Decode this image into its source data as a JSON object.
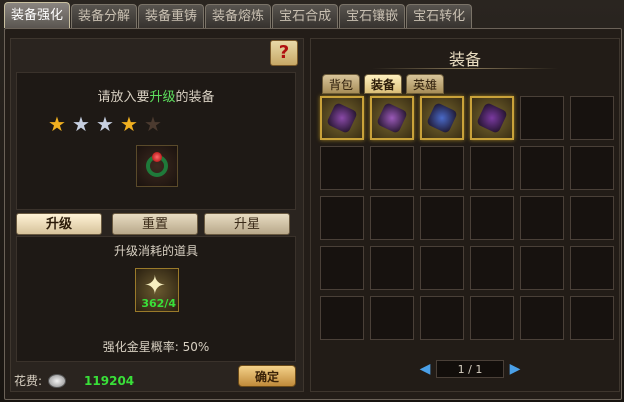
{
  "top_tabs": [
    "装备强化",
    "装备分解",
    "装备重铸",
    "装备熔炼",
    "宝石合成",
    "宝石镶嵌",
    "宝石转化"
  ],
  "active_top_tab": 0,
  "help_icon": "?",
  "prompt": {
    "prefix": "请放入要",
    "highlight": "升级",
    "suffix": "的装备"
  },
  "stars": [
    {
      "icon": "gold-star-icon",
      "glyph": "★"
    },
    {
      "icon": "silver-star-icon",
      "glyph": "★"
    },
    {
      "icon": "silver-star-icon",
      "glyph": "★"
    },
    {
      "icon": "gold-star-icon",
      "glyph": "★"
    },
    {
      "icon": "empty-star-icon",
      "glyph": "★"
    }
  ],
  "sub_tabs": [
    "升级",
    "重置",
    "升星"
  ],
  "active_sub_tab": 0,
  "cost_label": "升级消耗的道具",
  "material": {
    "icon": "star-material-icon",
    "glyph": "✦",
    "count": "362/4"
  },
  "success_rate": "强化金星概率: 50%",
  "cost_row": {
    "label": "花费:",
    "icon": "silver-coin-icon",
    "value": "119204"
  },
  "confirm_label": "确定",
  "right": {
    "title": "装备",
    "tabs": [
      "背包",
      "装备",
      "英雄"
    ],
    "active_tab": 1,
    "grid_rows": 5,
    "grid_cols": 6,
    "items": [
      {
        "icon": "purple-shoulder-armor-icon",
        "color": "#8a4aa8"
      },
      {
        "icon": "purple-helmet-icon",
        "color": "#9a5ab8"
      },
      {
        "icon": "blue-gauntlet-icon",
        "color": "#4a6ac8"
      },
      {
        "icon": "purple-shield-icon",
        "color": "#7a3aa0"
      }
    ],
    "page": "1 / 1"
  },
  "colors": {
    "gold": "#c9a23a",
    "green": "#39e039",
    "highlight": "#5ee05e"
  }
}
